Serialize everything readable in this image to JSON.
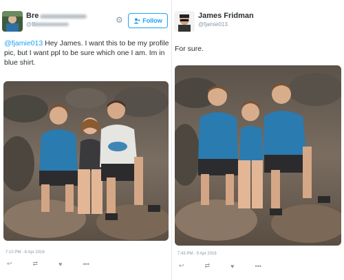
{
  "left_tweet": {
    "name": "Bre",
    "handle": "@B",
    "follow_label": "Follow",
    "mention": "@fjamie013",
    "text": " Hey James. I want this to be my profile pic, but I want ppl to be sure which one I am. Im in blue shirt.",
    "timestamp": "7:10 PM - 8 Apr 2016"
  },
  "right_tweet": {
    "name": "James Fridman",
    "handle": "@fjamie013",
    "text": "For sure.",
    "timestamp": "7:43 PM - 9 Apr 2016"
  },
  "icons": {
    "gear": "gear-icon",
    "follow": "add-user-icon",
    "reply": "reply-icon",
    "retweet": "retweet-icon",
    "like": "heart-icon",
    "more": "more-icon"
  },
  "colors": {
    "accent": "#1da1f2",
    "muted": "#8899a6",
    "blue_shirt": "#2a7bb0"
  }
}
